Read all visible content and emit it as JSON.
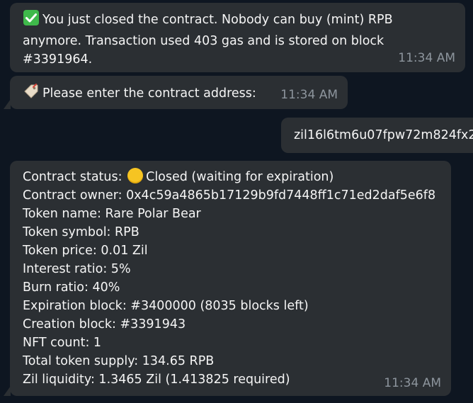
{
  "messages": {
    "closed": {
      "icon": "check-mark-button-icon",
      "text": "You just closed the contract. Nobody can buy (mint) RPB anymore. Transaction used 403 gas and is stored on block #3391964.",
      "line1": "You just closed the contract. Nobody can buy (mint) RPB",
      "line2": "anymore. Transaction used 403 gas and is stored on block",
      "line3": "#3391964.",
      "time": "11:34 AM"
    },
    "prompt": {
      "icon": "label-tag-icon",
      "text": "Please enter the contract address:",
      "time": "11:34 AM"
    },
    "reply": {
      "text": "zil16l6tm6u07fpw72m824fx2"
    },
    "status": {
      "status_label": "Contract status:",
      "status_icon": "yellow-circle-icon",
      "status_value": "Closed (waiting for expiration)",
      "owner": "Contract owner: 0x4c59a4865b17129b9fd7448ff1c71ed2daf5e6f8",
      "token_name": "Token name: Rare Polar Bear",
      "token_symbol": "Token symbol: RPB",
      "token_price": "Token price: 0.01 Zil",
      "interest_ratio": "Interest ratio: 5%",
      "burn_ratio": "Burn ratio: 40%",
      "expiration_block": "Expiration block: #3400000 (8035 blocks left)",
      "creation_block": "Creation block: #3391943",
      "nft_count": "NFT count: 1",
      "total_supply": "Total token supply: 134.65 RPB",
      "zil_liquidity": "Zil liquidity: 1.3465 Zil (1.413825 required)",
      "time": "11:34 AM"
    }
  },
  "colors": {
    "background": "#0e1621",
    "bubble": "#2b2f33",
    "text": "#f5f5f5",
    "timestamp": "#8d959d",
    "check_green": "#3fb94b",
    "status_yellow": "#f6c422"
  }
}
